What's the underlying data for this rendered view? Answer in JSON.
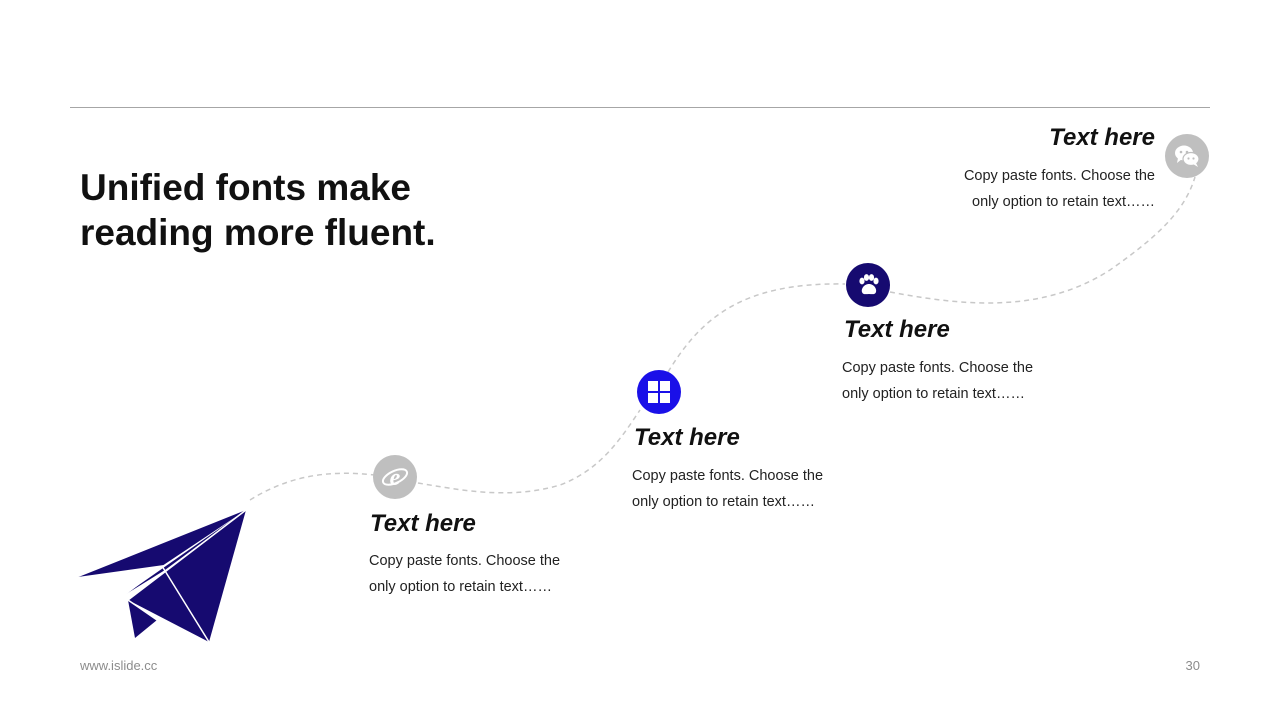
{
  "slide": {
    "headline_line1": "Unified fonts make",
    "headline_line2": "reading more fluent.",
    "footer_url": "www.islide.cc",
    "page_number": "30"
  },
  "steps": [
    {
      "icon": "internet-explorer-icon",
      "title": "Text here",
      "desc_line1": "Copy paste fonts. Choose the",
      "desc_line2": "only option to retain text……",
      "color": "#bfbfbf"
    },
    {
      "icon": "windows-icon",
      "title": "Text here",
      "desc_line1": "Copy paste fonts. Choose the",
      "desc_line2": "only option to retain text……",
      "color": "#1a10e8"
    },
    {
      "icon": "paw-icon",
      "title": "Text here",
      "desc_line1": "Copy paste fonts. Choose the",
      "desc_line2": "only option to retain text……",
      "color": "#160a70"
    },
    {
      "icon": "wechat-icon",
      "title": "Text here",
      "desc_line1": "Copy paste fonts. Choose the",
      "desc_line2": "only option to retain text……",
      "color": "#bfbfbf"
    }
  ],
  "colors": {
    "plane": "#160a70",
    "dashed_path": "#c8c8c8",
    "rule": "#a6a6a6"
  },
  "decor": {
    "plane_icon": "paper-plane-icon"
  }
}
